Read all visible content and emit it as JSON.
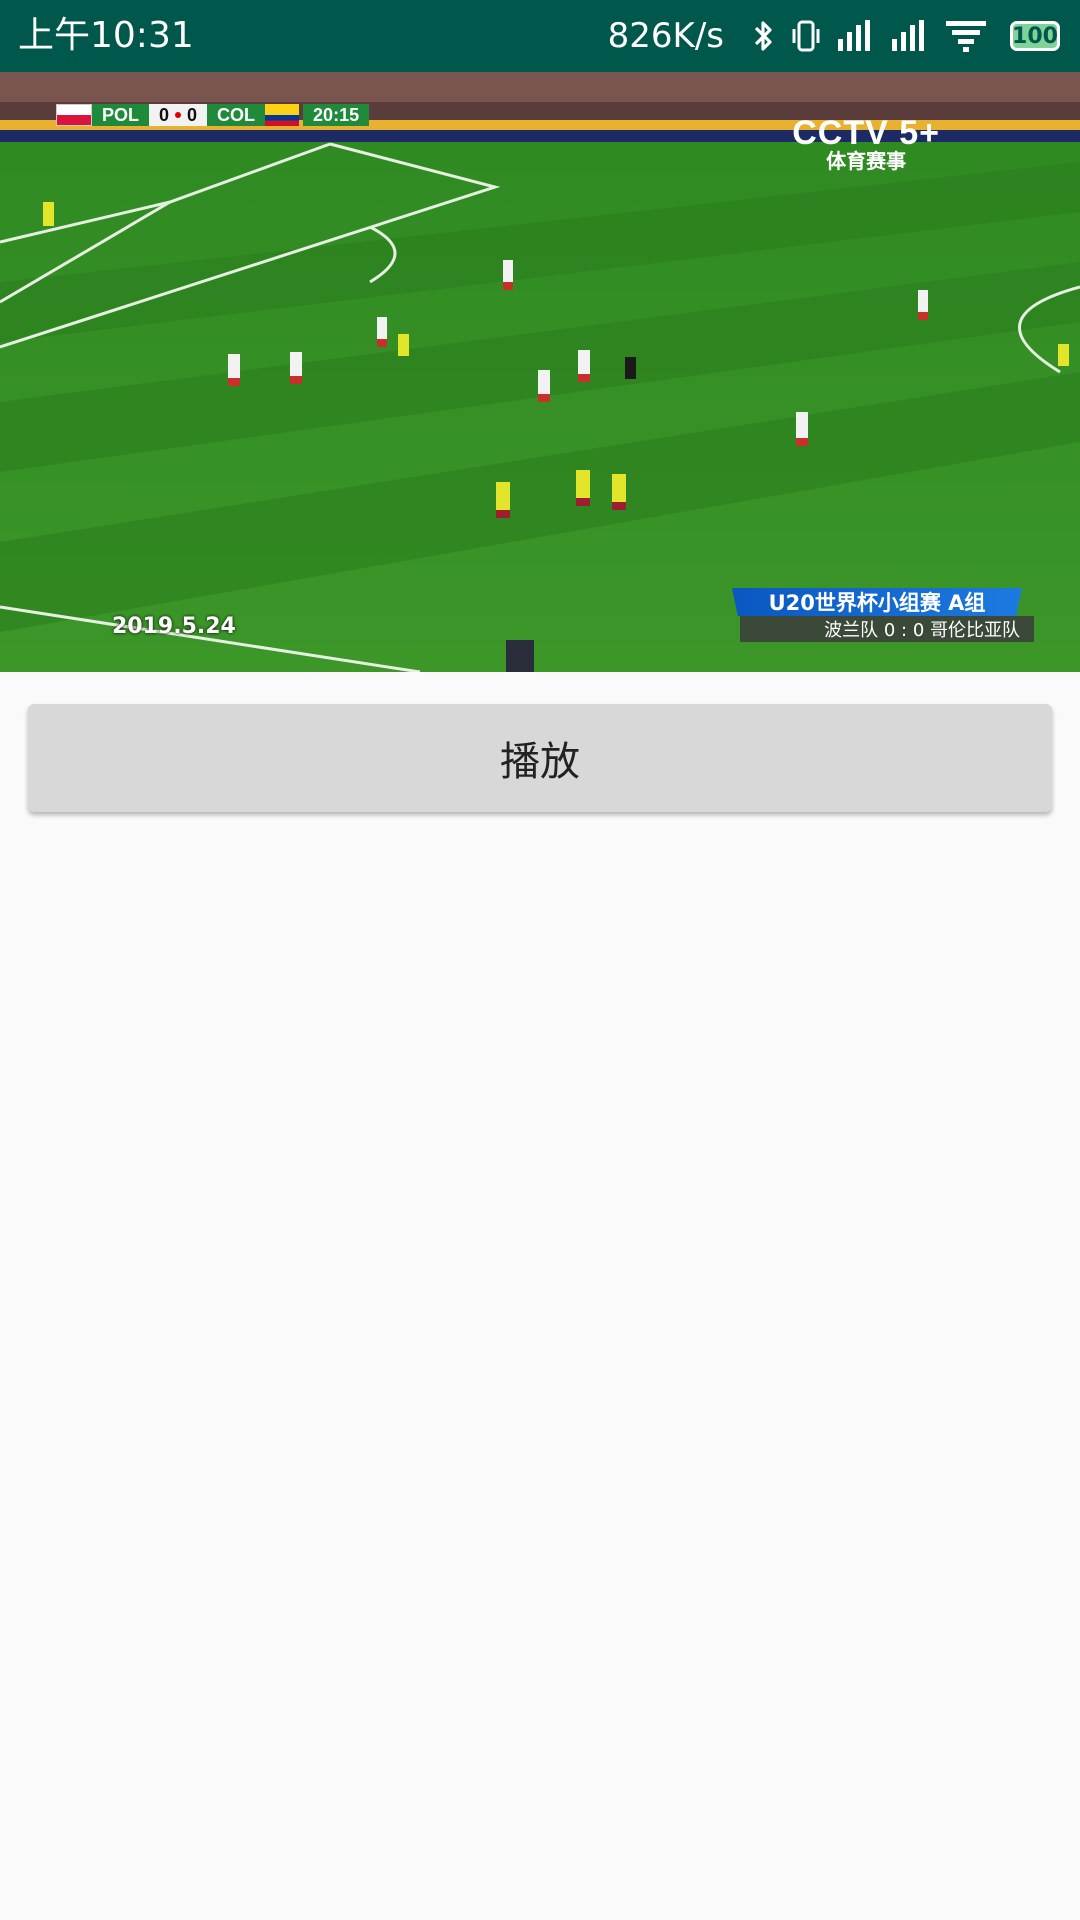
{
  "status_bar": {
    "time": "上午10:31",
    "net_speed": "826K/s",
    "icons": [
      "bluetooth-icon",
      "vibrate-icon",
      "signal-icon",
      "signal-icon",
      "wifi-icon",
      "battery-icon"
    ],
    "battery_level": "100",
    "background_color": "#00574b"
  },
  "video": {
    "scoreboard": {
      "home_team": "POL",
      "home_score": "0",
      "away_score": "0",
      "away_team": "COL",
      "match_time": "20:15"
    },
    "channel_logo": {
      "main": "CCTV 5+",
      "sub": "体育赛事"
    },
    "date": "2019.5.24",
    "lower_third": {
      "title": "U20世界杯小组赛  A组",
      "subtitle": "波兰队 0 : 0 哥伦比亚队"
    }
  },
  "play_button": {
    "label": "播放"
  }
}
